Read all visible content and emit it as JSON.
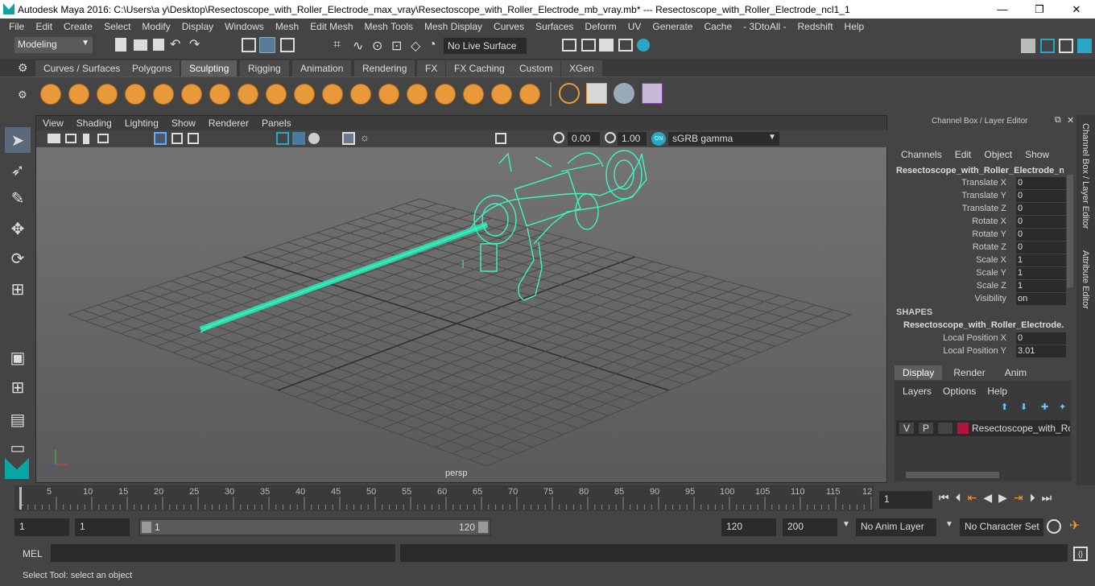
{
  "title": {
    "text": "Autodesk Maya 2016: C:\\Users\\a y\\Desktop\\Resectoscope_with_Roller_Electrode_max_vray\\Resectoscope_with_Roller_Electrode_mb_vray.mb*   ---   Resectoscope_with_Roller_Electrode_ncl1_1",
    "minimize": "—",
    "maximize": "❐",
    "close": "✕"
  },
  "menubar": [
    "File",
    "Edit",
    "Create",
    "Select",
    "Modify",
    "Display",
    "Windows",
    "Mesh",
    "Edit Mesh",
    "Mesh Tools",
    "Mesh Display",
    "Curves",
    "Surfaces",
    "Deform",
    "UV",
    "Generate",
    "Cache",
    "- 3DtoAll -",
    "Redshift",
    "Help"
  ],
  "status": {
    "mode": "Modeling",
    "live_surface": "No Live Surface"
  },
  "shelf_tabs": [
    "Curves / Surfaces",
    "Polygons",
    "Sculpting",
    "Rigging",
    "Animation",
    "Rendering",
    "FX",
    "FX Caching",
    "Custom",
    "XGen"
  ],
  "active_shelf_tab": "Sculpting",
  "viewport": {
    "menus": [
      "View",
      "Shading",
      "Lighting",
      "Show",
      "Renderer",
      "Panels"
    ],
    "exposure": "0.00",
    "gamma": "1.00",
    "color_space": "sGRB gamma",
    "camera_label": "persp"
  },
  "channel_box": {
    "header": "Channel Box / Layer Editor",
    "menus": [
      "Channels",
      "Edit",
      "Object",
      "Show"
    ],
    "object_name": "Resectoscope_with_Roller_Electrode_n...",
    "attributes": [
      {
        "label": "Translate X",
        "value": "0"
      },
      {
        "label": "Translate Y",
        "value": "0"
      },
      {
        "label": "Translate Z",
        "value": "0"
      },
      {
        "label": "Rotate X",
        "value": "0"
      },
      {
        "label": "Rotate Y",
        "value": "0"
      },
      {
        "label": "Rotate Z",
        "value": "0"
      },
      {
        "label": "Scale X",
        "value": "1"
      },
      {
        "label": "Scale Y",
        "value": "1"
      },
      {
        "label": "Scale Z",
        "value": "1"
      },
      {
        "label": "Visibility",
        "value": "on"
      }
    ],
    "shapes_header": "SHAPES",
    "shape_name": "Resectoscope_with_Roller_Electrode...",
    "shape_attributes": [
      {
        "label": "Local Position X",
        "value": "0"
      },
      {
        "label": "Local Position Y",
        "value": "3.01"
      }
    ]
  },
  "layer_editor": {
    "tabs": [
      "Display",
      "Render",
      "Anim"
    ],
    "active_tab": "Display",
    "menus": [
      "Layers",
      "Options",
      "Help"
    ],
    "layer": {
      "v": "V",
      "p": "P",
      "name": "Resectoscope_with_Roll",
      "color": "#b0163a"
    }
  },
  "side_tabs": [
    "Channel Box / Layer Editor",
    "Attribute Editor"
  ],
  "timeline": {
    "ticks": [
      "5",
      "10",
      "15",
      "20",
      "25",
      "30",
      "35",
      "40",
      "45",
      "50",
      "55",
      "60",
      "65",
      "70",
      "75",
      "80",
      "85",
      "90",
      "95",
      "100",
      "105",
      "110",
      "115",
      "12"
    ],
    "start_tick": "1",
    "current_frame": "1"
  },
  "range": {
    "start": "1",
    "playback_start": "1",
    "slider_start": "1",
    "slider_end": "120",
    "playback_end": "120",
    "end": "200",
    "anim_layer": "No Anim Layer",
    "character_set": "No Character Set"
  },
  "mel_label": "MEL",
  "help_text": "Select Tool: select an object"
}
